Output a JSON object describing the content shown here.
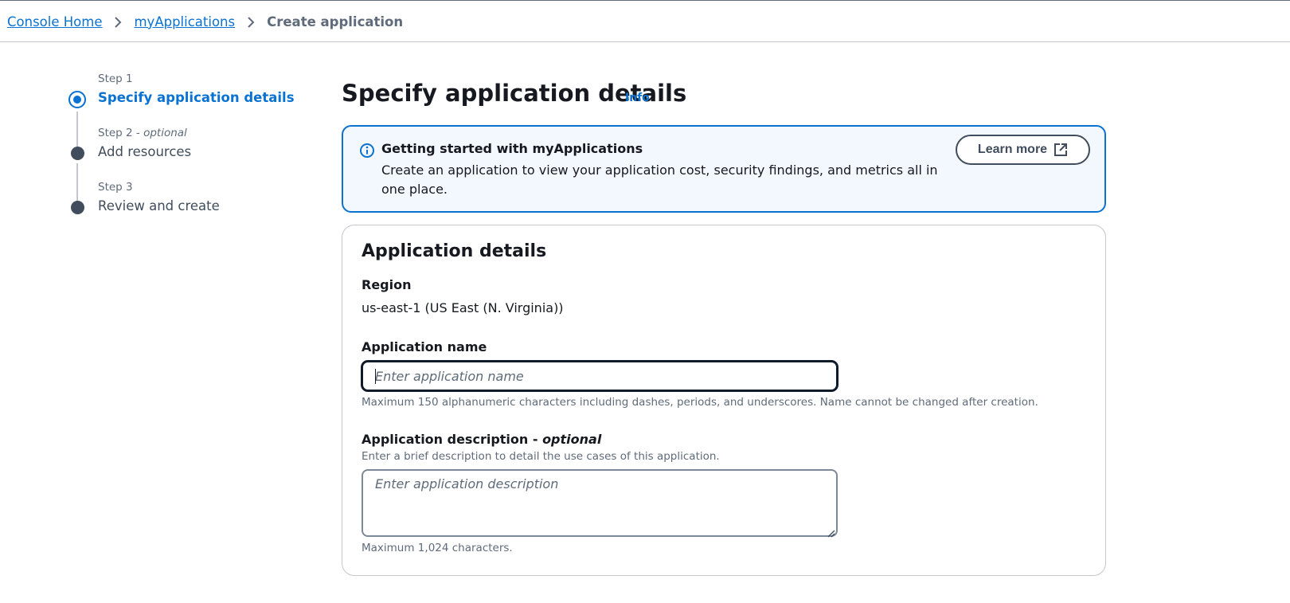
{
  "breadcrumb": {
    "items": [
      "Console Home",
      "myApplications"
    ],
    "current": "Create application"
  },
  "steps": [
    {
      "number": "Step 1",
      "optional": "",
      "title": "Specify application details",
      "state": "active"
    },
    {
      "number": "Step 2 - ",
      "optional": "optional",
      "title": "Add resources",
      "state": "inactive"
    },
    {
      "number": "Step 3",
      "optional": "",
      "title": "Review and create",
      "state": "inactive"
    }
  ],
  "page": {
    "title": "Specify application details",
    "info_link": "Info"
  },
  "alert": {
    "heading": "Getting started with myApplications",
    "body": "Create an application to view your application cost, security findings, and metrics all in one place.",
    "button_label": "Learn more",
    "icon": "info-circle-icon",
    "button_icon": "external-link-icon"
  },
  "details": {
    "title": "Application details",
    "region_label": "Region",
    "region_value": "us-east-1 (US East (N. Virginia))",
    "name_label": "Application name",
    "name_value": "",
    "name_placeholder": "Enter application name",
    "name_hint": "Maximum 150 alphanumeric characters including dashes, periods, and underscores. Name cannot be changed after creation.",
    "description_label": "Application description - ",
    "description_label_optional": "optional",
    "description_help": "Enter a brief description to detail the use cases of this application.",
    "description_value": "",
    "description_placeholder": "Enter application description",
    "description_hint": "Maximum 1,024 characters."
  },
  "colors": {
    "accent": "#0972d3",
    "alert_background": "#f2f8fd",
    "text_primary": "#16191f",
    "text_secondary": "#5f6b7a"
  }
}
